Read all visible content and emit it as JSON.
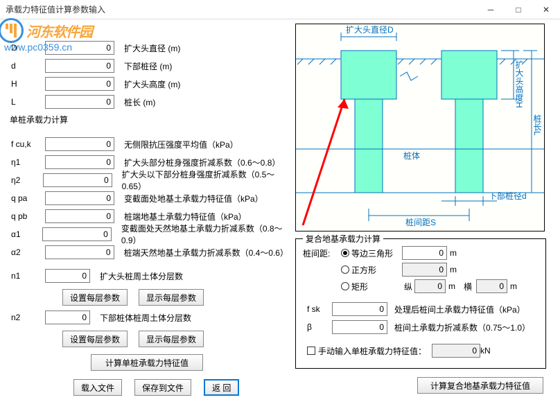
{
  "window": {
    "title": "承载力特征值计算参数输入"
  },
  "watermark": {
    "site_name": "河东软件园",
    "url": "www.pc0359.cn"
  },
  "geom": {
    "D": {
      "label": "D",
      "value": "0",
      "desc": "扩大头直径 (m)"
    },
    "d": {
      "label": "d",
      "value": "0",
      "desc": "下部桩径 (m)"
    },
    "H": {
      "label": "H",
      "value": "0",
      "desc": "扩大头高度 (m)"
    },
    "L": {
      "label": "L",
      "value": "0",
      "desc": "桩长 (m)"
    }
  },
  "single": {
    "title": "单桩承载力计算",
    "fcuk": {
      "label": "f cu,k",
      "value": "0",
      "desc": "无侧限抗压强度平均值（kPa）"
    },
    "eta1": {
      "label": "η1",
      "value": "0",
      "desc": "扩大头部分桩身强度折减系数（0.6～0.8）"
    },
    "eta2": {
      "label": "η2",
      "value": "0",
      "desc": "扩大头以下部分桩身强度折减系数（0.5～0.65）"
    },
    "qpa": {
      "label": "q pa",
      "value": "0",
      "desc": "变截面处地基土承载力特征值（kPa）"
    },
    "qpb": {
      "label": "q pb",
      "value": "0",
      "desc": "桩端地基土承载力特征值（kPa）"
    },
    "a1": {
      "label": "α1",
      "value": "0",
      "desc": "变截面处天然地基土承载力折减系数（0.8～0.9）"
    },
    "a2": {
      "label": "α2",
      "value": "0",
      "desc": "桩端天然地基土承载力折减系数（0.4～0.6）"
    },
    "n1": {
      "label": "n1",
      "value": "0",
      "desc": "扩大头桩周土体分层数"
    },
    "n2": {
      "label": "n2",
      "value": "0",
      "desc": "下部桩体桩周土体分层数"
    },
    "btn_set": "设置每层参数",
    "btn_show": "显示每层参数",
    "calc_btn": "计算单桩承载力特征值"
  },
  "footer": {
    "load": "载入文件",
    "save": "保存到文件",
    "back": "返  回"
  },
  "diagram": {
    "D_label": "扩大头直径D",
    "H_label": "扩大头高度H",
    "L_label": "桩长L",
    "body_label": "桩体",
    "d_label": "下部桩径d",
    "S_label": "桩间距S"
  },
  "composite": {
    "title": "复合地基承载力计算",
    "spacing_label": "桩间距:",
    "tri": {
      "label": "等边三角形",
      "value": "0",
      "unit": "m"
    },
    "sq": {
      "label": "正方形",
      "value": "0",
      "unit": "m"
    },
    "rect": {
      "label": "矩形",
      "v_lbl": "纵",
      "v_val": "0",
      "h_lbl": "横",
      "h_val": "0",
      "unit": "m"
    },
    "fsk": {
      "label": "f sk",
      "value": "0",
      "desc": "处理后桩间土承载力特征值（kPa）"
    },
    "beta": {
      "label": "β",
      "value": "0",
      "desc": "桩间土承载力折减系数（0.75～1.0）"
    },
    "manual": {
      "label": "手动输入单桩承载力特征值：",
      "value": "0",
      "unit": "kN"
    },
    "calc_btn": "计算复合地基承载力特征值"
  }
}
